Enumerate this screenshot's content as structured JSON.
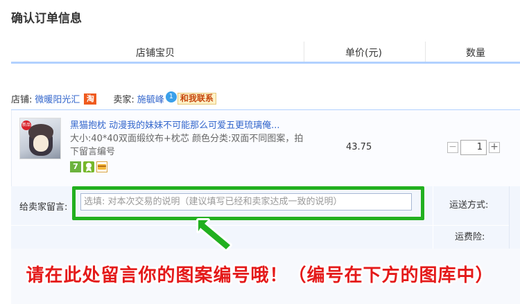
{
  "page": {
    "title": "确认订单信息"
  },
  "columns": {
    "item": "店铺宝贝",
    "price": "单价(元)",
    "qty": "数量"
  },
  "shop": {
    "label": "店铺:",
    "name": "微暖阳光汇",
    "badge": "淘",
    "seller_label": "卖家:",
    "seller_name": "施毓峰",
    "ww_icon": "1",
    "contact": "和我联系"
  },
  "item": {
    "title": "黑猫抱枕 动漫我的妹妹不可能那么可爱五更琉璃俺...",
    "spec": "大小:40*40双面缎纹布+枕芯  颜色分类:双面不同图案，拍下留言编号",
    "icon_seven": "7",
    "price": "43.75",
    "quantity": "1",
    "minus": "−",
    "plus": "+",
    "thumb_tag": "新品"
  },
  "message": {
    "label": "给卖家留言:",
    "placeholder": "选填: 对本次交易的说明（建议填写已经和卖家达成一致的说明）"
  },
  "shipping": {
    "method_label": "运送方式:",
    "insurance_label": "运费险:"
  },
  "banner": {
    "text": "请在此处留言你的图案编号哦！（编号在下方的图库中）"
  },
  "colors": {
    "link": "#3366cc",
    "highlight_box": "#22b01f",
    "banner": "#e41a1a",
    "header_line": "#b2d1ff"
  }
}
